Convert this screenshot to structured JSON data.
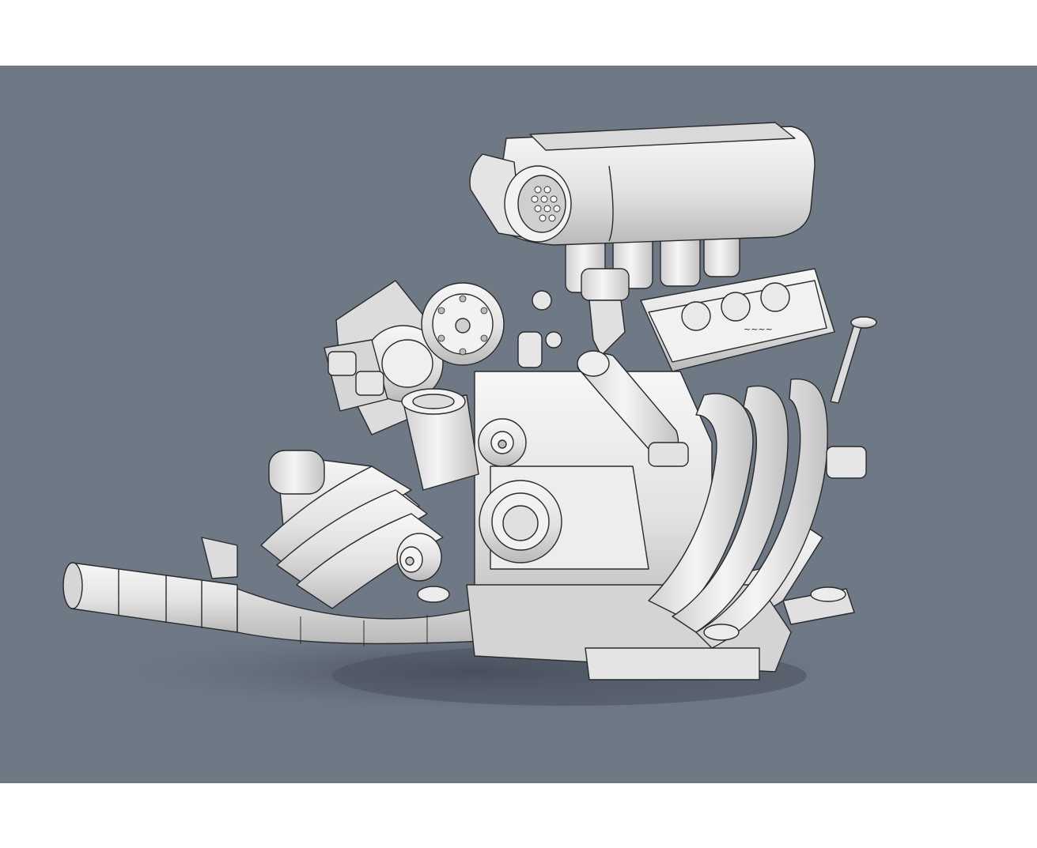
{
  "scene": {
    "subject": "",
    "background_color": "#6f7885",
    "part_fill": "#e9e9e9",
    "part_shade": "#bdbdbd",
    "edge_color": "#2a2a2a",
    "shadow_color": "#4a5260"
  },
  "engraving": {
    "valve_cover_text": "~~~~"
  }
}
